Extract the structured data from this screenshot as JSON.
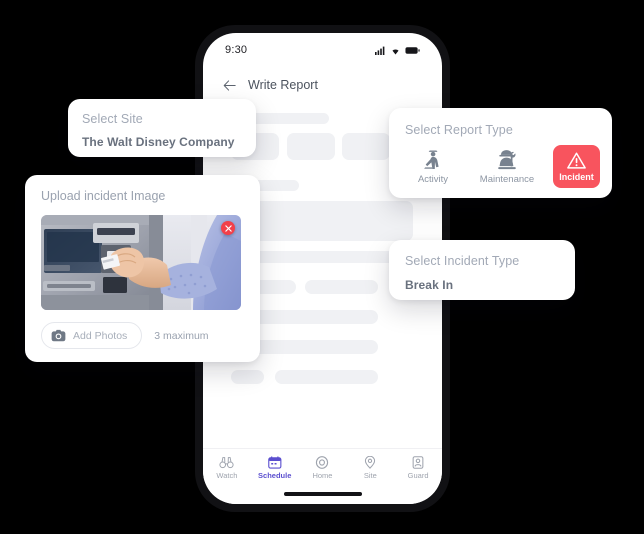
{
  "phone": {
    "status_bar": {
      "time": "9:30",
      "icons": [
        "signal-icon",
        "wifi-icon",
        "battery-icon"
      ]
    },
    "header": {
      "back_icon": "back-arrow-icon",
      "title": "Write Report"
    },
    "bottom_nav": [
      {
        "label": "Watch",
        "icon": "binoculars-icon",
        "active": false
      },
      {
        "label": "Schedule",
        "icon": "calendar-icon",
        "active": true
      },
      {
        "label": "Home",
        "icon": "home-ring-icon",
        "active": false
      },
      {
        "label": "Site",
        "icon": "map-pin-icon",
        "active": false
      },
      {
        "label": "Guard",
        "icon": "guard-badge-icon",
        "active": false
      }
    ],
    "active_color": "#5B4FCF"
  },
  "cards": {
    "select_site": {
      "label": "Select Site",
      "value": "The Walt Disney Company"
    },
    "select_report_type": {
      "label": "Select Report Type",
      "options": [
        {
          "label": "Activity",
          "icon": "walking-guard-icon",
          "selected": false
        },
        {
          "label": "Maintenance",
          "icon": "worker-wrench-icon",
          "selected": false
        },
        {
          "label": "Incident",
          "icon": "warning-triangle-icon",
          "selected": true
        }
      ],
      "selected_color": "#F8545E"
    },
    "select_incident_type": {
      "label": "Select Incident Type",
      "value": "Break In"
    },
    "upload": {
      "title": "Upload incident Image",
      "photo_alt": "hand-inserting-card-into-atm",
      "delete_icon": "close-x-icon",
      "add_photos_label": "Add Photos",
      "add_photos_icon": "camera-icon",
      "max_label": "3 maximum"
    }
  },
  "theme": {
    "background": "#000000",
    "card_background": "#FFFFFF",
    "label_text": "#A2A9B6",
    "value_text": "#69717E",
    "skeleton": "#F0F1F4"
  }
}
